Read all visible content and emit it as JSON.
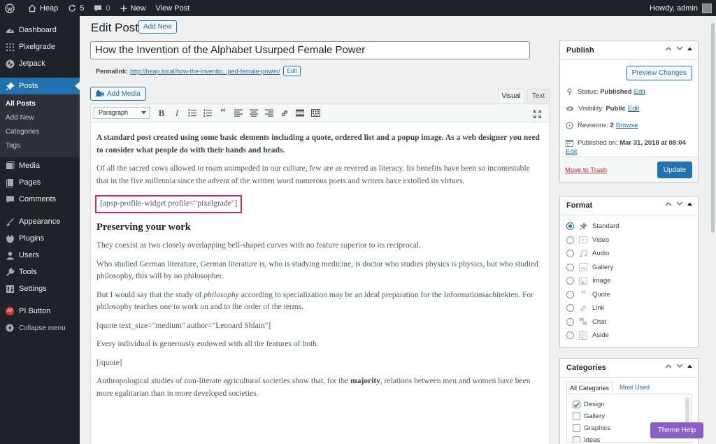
{
  "adminbar": {
    "site_name": "Heap",
    "updates_count": "5",
    "comments_count": "0",
    "new_label": "New",
    "view_post_label": "View Post",
    "howdy": "Howdy, admin"
  },
  "sidebar": {
    "items": [
      {
        "label": "Dashboard",
        "icon": "dashboard-icon"
      },
      {
        "label": "Pixelgrade",
        "icon": "grid-icon"
      },
      {
        "label": "Jetpack",
        "icon": "jetpack-icon"
      },
      {
        "label": "Posts",
        "icon": "pin-icon",
        "active": true
      },
      {
        "label": "Media",
        "icon": "media-icon"
      },
      {
        "label": "Pages",
        "icon": "pages-icon"
      },
      {
        "label": "Comments",
        "icon": "comments-icon"
      },
      {
        "label": "Appearance",
        "icon": "appearance-icon"
      },
      {
        "label": "Plugins",
        "icon": "plugins-icon"
      },
      {
        "label": "Users",
        "icon": "users-icon"
      },
      {
        "label": "Tools",
        "icon": "tools-icon"
      },
      {
        "label": "Settings",
        "icon": "settings-icon"
      },
      {
        "label": "PI Button",
        "icon": "pi-button-icon"
      },
      {
        "label": "Collapse menu",
        "icon": "collapse-icon"
      }
    ],
    "posts_submenu": [
      "All Posts",
      "Add New",
      "Categories",
      "Tags"
    ],
    "pi_badge": "AP"
  },
  "page": {
    "title": "Edit Post",
    "add_new": "Add New",
    "post_title": "How the Invention of the Alphabet Usurped Female Power",
    "permalink_label": "Permalink:",
    "permalink_url": "http://heap.local/how-the-inventio...ped-female-power/",
    "permalink_edit": "Edit",
    "add_media": "Add Media",
    "tab_visual": "Visual",
    "tab_text": "Text",
    "format_select": "Paragraph"
  },
  "content": {
    "lead": "A standard post created using some basic elements including a quote, ordered list and a popup image. As a web designer you need to consider what people do with their hands and heads.",
    "p1": "Of all the sacred cows allowed to roam unimpeded in our culture, few are as revered as literacy. Its benefits have been so incontestable that in the five millennia since the advent of the written word numerous poets and writers have extolled its virtues.",
    "shortcode": "[apsp-profile-widget profile=\"pixelgrade\"]",
    "heading": "Preserving your work",
    "p2": "They coexist as two closely overlapping bell-shaped curves with no feature superior to its reciprocal.",
    "p3": "Who studied German literature, German literature is, who is studying medicine, is doctor who studies physics is physics, but who studied philosophy, this will by no philosopher.",
    "p4_a": "But I would say that the study of ",
    "p4_em": "philosophy",
    "p4_b": " according to specialization may be an ideal preparation for the Informationsachitekten. For philosophy teaches one to work on and to the order of the terms.",
    "quote_open": "[quote text_size=\"medium\" author=\"Leonard Shlain\"]",
    "p5": "Every individual is generously endowed with all the features of both.",
    "quote_close": "[/quote]",
    "p6_a": "Anthropological studies of non-literate agricultural societies show that, for the ",
    "p6_b": "majority",
    "p6_c": ", relations between men and women have been more egalitarian than in more developed societies."
  },
  "publish": {
    "title": "Publish",
    "preview": "Preview Changes",
    "status_label": "Status:",
    "status_value": "Published",
    "visibility_label": "Visibility:",
    "visibility_value": "Public",
    "revisions_label": "Revisions:",
    "revisions_value": "2",
    "browse": "Browse",
    "published_label": "Published on:",
    "published_value": "Mar 31, 2018 at 08:04",
    "edit": "Edit",
    "trash": "Move to Trash",
    "update": "Update"
  },
  "format": {
    "title": "Format",
    "options": [
      "Standard",
      "Video",
      "Audio",
      "Gallery",
      "Image",
      "Quote",
      "Link",
      "Chat",
      "Aside"
    ],
    "selected": "Standard"
  },
  "categories": {
    "title": "Categories",
    "tab_all": "All Categories",
    "tab_used": "Most Used",
    "items": [
      {
        "label": "Design",
        "checked": true
      },
      {
        "label": "Gallery",
        "checked": false
      },
      {
        "label": "Graphics",
        "checked": false
      },
      {
        "label": "Ideas",
        "checked": false
      }
    ]
  },
  "theme_help": "Theme Help",
  "colors": {
    "accent": "#2271b1",
    "adminbar": "#1d2327",
    "highlight_box": "#d6246e",
    "theme_help": "#8c5fc7"
  }
}
